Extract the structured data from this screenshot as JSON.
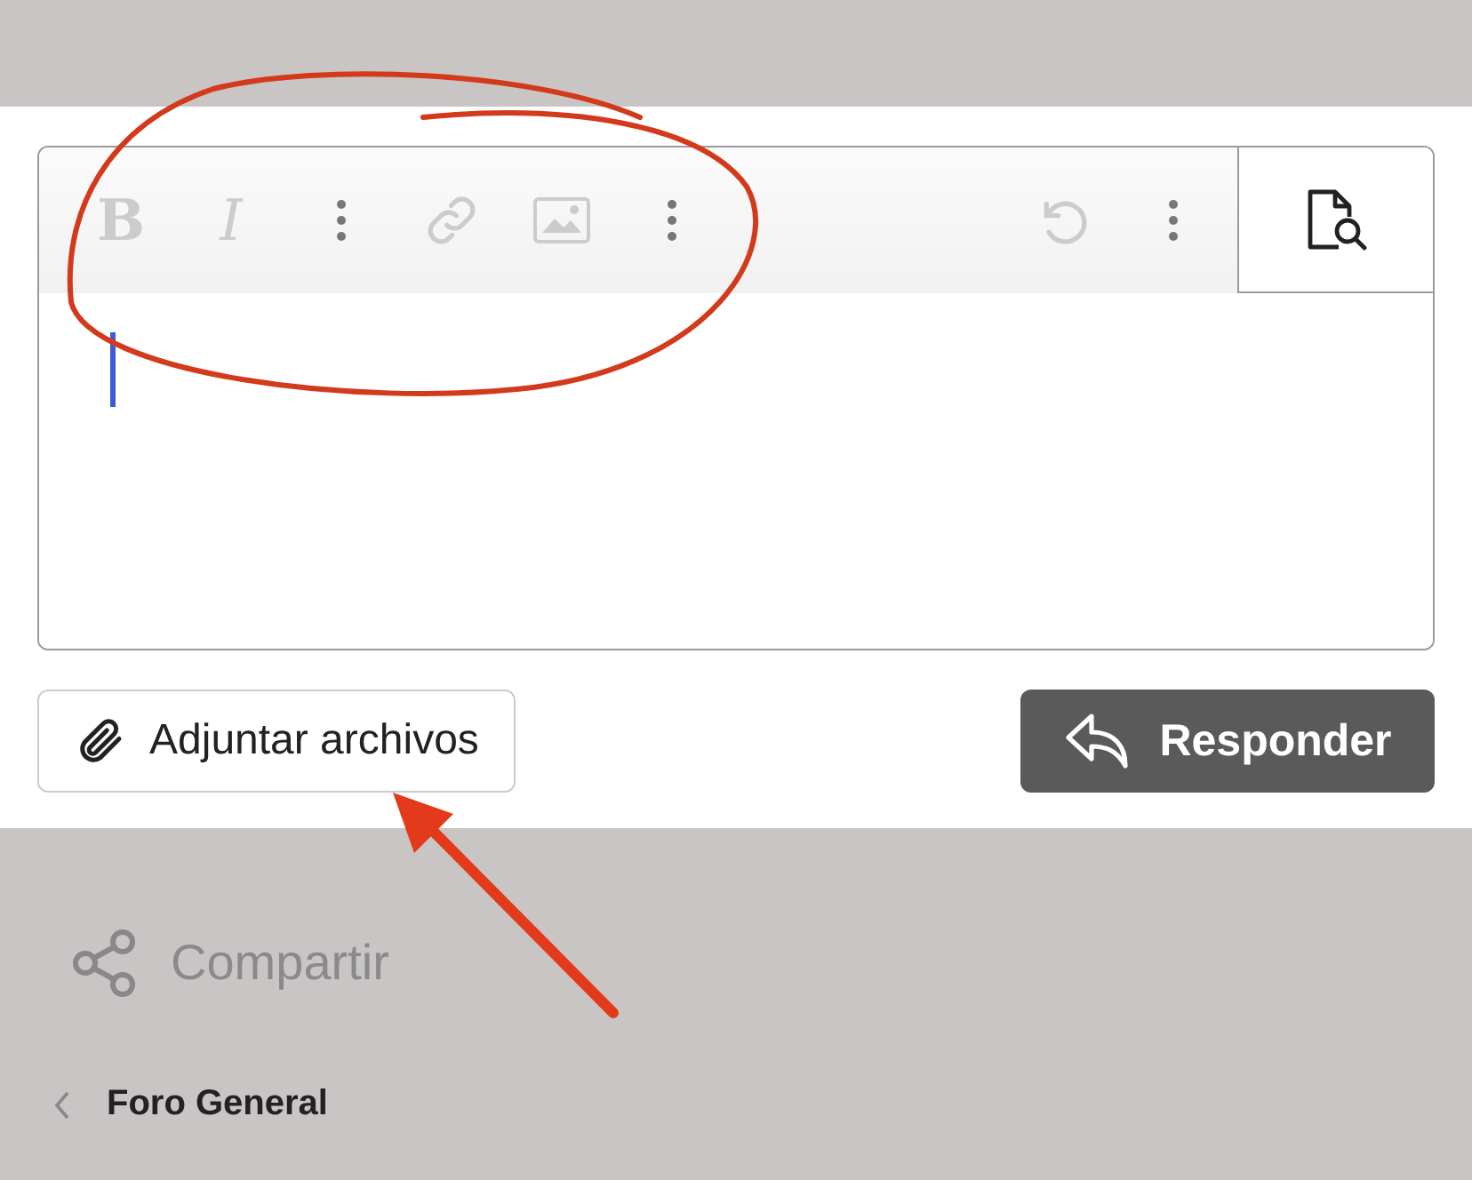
{
  "editor": {
    "toolbar_left": [
      {
        "kind": "bold",
        "label": "B"
      },
      {
        "kind": "italic",
        "label": "I"
      },
      {
        "kind": "more"
      },
      {
        "kind": "link"
      },
      {
        "kind": "image"
      },
      {
        "kind": "more"
      }
    ],
    "toolbar_right": [
      {
        "kind": "undo"
      },
      {
        "kind": "more"
      }
    ],
    "focused": true
  },
  "attach_button": {
    "label": "Adjuntar archivos"
  },
  "reply_button": {
    "label": "Responder"
  },
  "share": {
    "label": "Compartir"
  },
  "breadcrumb": {
    "label": "Foro General"
  }
}
